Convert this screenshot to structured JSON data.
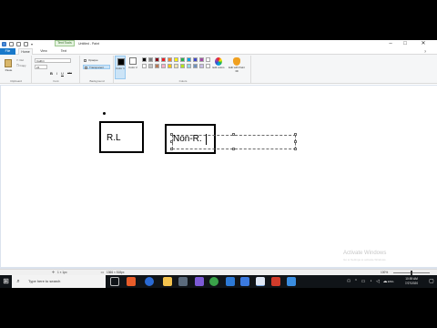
{
  "window": {
    "title": "Untitled - Paint",
    "context_tab": "Text Tools"
  },
  "tabs": {
    "file": "File",
    "home": "Home",
    "view": "View",
    "text": "Text"
  },
  "ribbon": {
    "clipboard": {
      "paste_label": "Paste",
      "cut_label": "Cut",
      "copy_label": "Copy",
      "group_label": "Clipboard"
    },
    "font": {
      "family": "Calibri",
      "size": "24",
      "bold": "B",
      "italic": "I",
      "underline": "U",
      "strike": "abc",
      "group_label": "Font"
    },
    "background": {
      "opaque_label": "Opaque",
      "transparent_label": "Transparent",
      "group_label": "Background"
    },
    "colors": {
      "color1_label": "Color 1",
      "color2_label": "Color 2",
      "group_label": "Colors",
      "edit_colors_label": "Edit colors",
      "paint3d_label": "Edit with Paint 3D",
      "color1": "#000000",
      "color2": "#ffffff",
      "palette_top": [
        "#000000",
        "#7f7f7f",
        "#880015",
        "#ed1c24",
        "#ff7f27",
        "#fff200",
        "#22b14c",
        "#00a2e8",
        "#3f48cc",
        "#a349a4"
      ],
      "palette_bottom": [
        "#ffffff",
        "#c3c3c3",
        "#b97a57",
        "#ffaec9",
        "#ffc90e",
        "#efe4b0",
        "#b5e61d",
        "#99d9ea",
        "#7092be",
        "#c8bfe7"
      ]
    }
  },
  "canvas": {
    "box1_text": "R.L",
    "box2_text": "Non-R.",
    "watermark_title": "Activate Windows",
    "watermark_sub": "Go to Settings to activate Windows."
  },
  "statusbar": {
    "cursor_pos": "1 × 1px",
    "canvas_size": "1366 × 518px",
    "zoom": "100%",
    "zoom_level": 0.5
  },
  "taskbar": {
    "search_placeholder": "Type here to search",
    "lang": "ENG",
    "time": "10:59 AM",
    "date": "7/27/2020"
  }
}
